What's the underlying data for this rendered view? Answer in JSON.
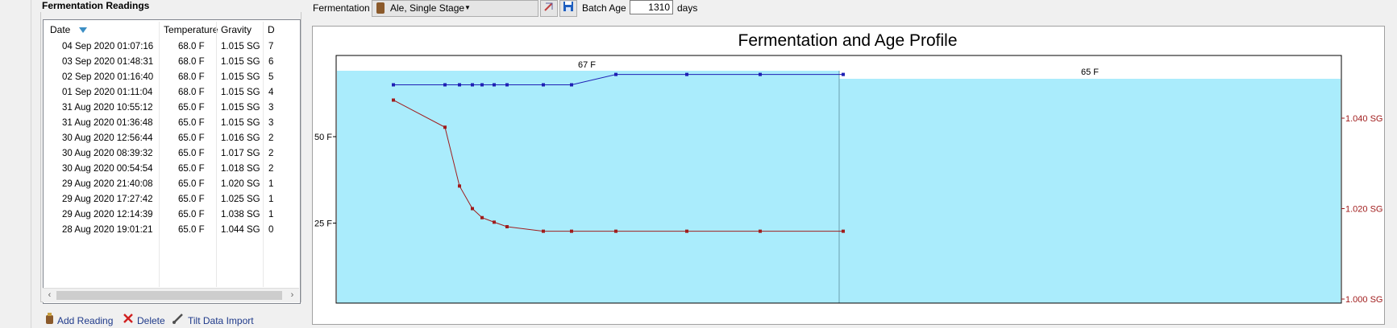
{
  "readings_panel": {
    "title": "Fermentation Readings",
    "columns": {
      "date": "Date",
      "temperature": "Temperature",
      "gravity": "Gravity",
      "days": "D"
    },
    "rows": [
      {
        "date": "04 Sep 2020 01:07:16",
        "temp": "68.0 F",
        "gravity": "1.015 SG",
        "days": "7"
      },
      {
        "date": "03 Sep 2020 01:48:31",
        "temp": "68.0 F",
        "gravity": "1.015 SG",
        "days": "6"
      },
      {
        "date": "02 Sep 2020 01:16:40",
        "temp": "68.0 F",
        "gravity": "1.015 SG",
        "days": "5"
      },
      {
        "date": "01 Sep 2020 01:11:04",
        "temp": "68.0 F",
        "gravity": "1.015 SG",
        "days": "4"
      },
      {
        "date": "31 Aug 2020 10:55:12",
        "temp": "65.0 F",
        "gravity": "1.015 SG",
        "days": "3"
      },
      {
        "date": "31 Aug 2020 01:36:48",
        "temp": "65.0 F",
        "gravity": "1.015 SG",
        "days": "3"
      },
      {
        "date": "30 Aug 2020 12:56:44",
        "temp": "65.0 F",
        "gravity": "1.016 SG",
        "days": "2"
      },
      {
        "date": "30 Aug 2020 08:39:32",
        "temp": "65.0 F",
        "gravity": "1.017 SG",
        "days": "2"
      },
      {
        "date": "30 Aug 2020 00:54:54",
        "temp": "65.0 F",
        "gravity": "1.018 SG",
        "days": "2"
      },
      {
        "date": "29 Aug 2020 21:40:08",
        "temp": "65.0 F",
        "gravity": "1.020 SG",
        "days": "1"
      },
      {
        "date": "29 Aug 2020 17:27:42",
        "temp": "65.0 F",
        "gravity": "1.025 SG",
        "days": "1"
      },
      {
        "date": "29 Aug 2020 12:14:39",
        "temp": "65.0 F",
        "gravity": "1.038 SG",
        "days": "1"
      },
      {
        "date": "28 Aug 2020 19:01:21",
        "temp": "65.0 F",
        "gravity": "1.044 SG",
        "days": "0"
      }
    ],
    "sort_icon": "sort-descending-icon"
  },
  "bottom_actions": {
    "add_reading": "Add Reading",
    "delete": "Delete",
    "tilt_import": "Tilt Data Import"
  },
  "toolbar": {
    "fermentation_label": "Fermentation",
    "fermentation_value": "Ale, Single Stage",
    "batch_age_label": "Batch Age",
    "batch_age_value": "1310",
    "batch_age_unit": "days"
  },
  "chart_data": {
    "type": "line",
    "title": "Fermentation and Age Profile",
    "stage_labels": [
      "67 F",
      "65 F"
    ],
    "left_axis": {
      "ticks": [
        "50 F",
        "25 F"
      ],
      "tick_values": [
        50,
        25
      ]
    },
    "right_axis": {
      "ticks": [
        "1.040 SG",
        "1.020 SG",
        "1.000 SG"
      ],
      "tick_values": [
        1.04,
        1.02,
        1.0
      ]
    },
    "series": [
      {
        "color": "#1f1fb4",
        "y": [
          65.0,
          65.0,
          65.0,
          65.0,
          65.0,
          65.0,
          65.0,
          65.0,
          65.0,
          68.0,
          68.0,
          68.0,
          68.0
        ]
      },
      {
        "color": "#a01c1c",
        "y": [
          1.044,
          1.038,
          1.025,
          1.02,
          1.018,
          1.017,
          1.016,
          1.015,
          1.015,
          1.015,
          1.015,
          1.015,
          1.015
        ]
      }
    ],
    "fill_color": "#aaecfc",
    "grid": false
  }
}
